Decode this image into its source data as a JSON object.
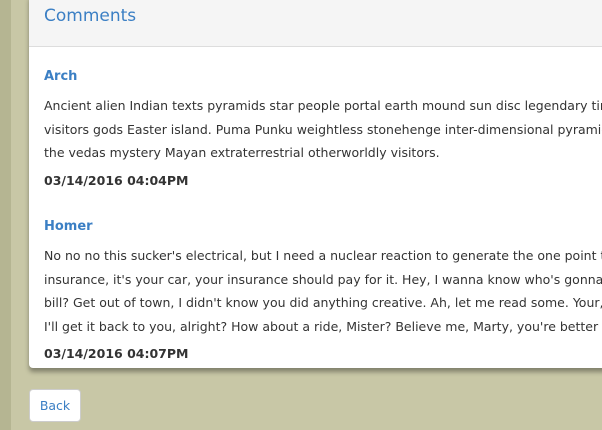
{
  "panel": {
    "title": "Comments"
  },
  "comments": [
    {
      "author": "Arch",
      "lines": [
        "Ancient alien Indian texts pyramids star people portal earth mound sun disc legendary times co",
        "visitors gods Easter island. Puma Punku weightless stonehenge inter-dimensional pyramids I kn",
        "the vedas mystery Mayan extraterrestrial otherworldly visitors."
      ],
      "date": "03/14/2016 04:04PM"
    },
    {
      "author": "Homer",
      "lines": [
        "No no no this sucker's electrical, but I need a nuclear reaction to generate the one point twenty",
        "insurance, it's your car, your insurance should pay for it. Hey, I wanna know who's gonna pay fo",
        "bill? Get out of town, I didn't know you did anything creative. Ah, let me read some. Your, your",
        "I'll get it back to you, alright? How about a ride, Mister? Believe me, Marty, you're better off not"
      ],
      "date": "03/14/2016 04:07PM"
    }
  ],
  "actions": {
    "back_label": "Back"
  }
}
